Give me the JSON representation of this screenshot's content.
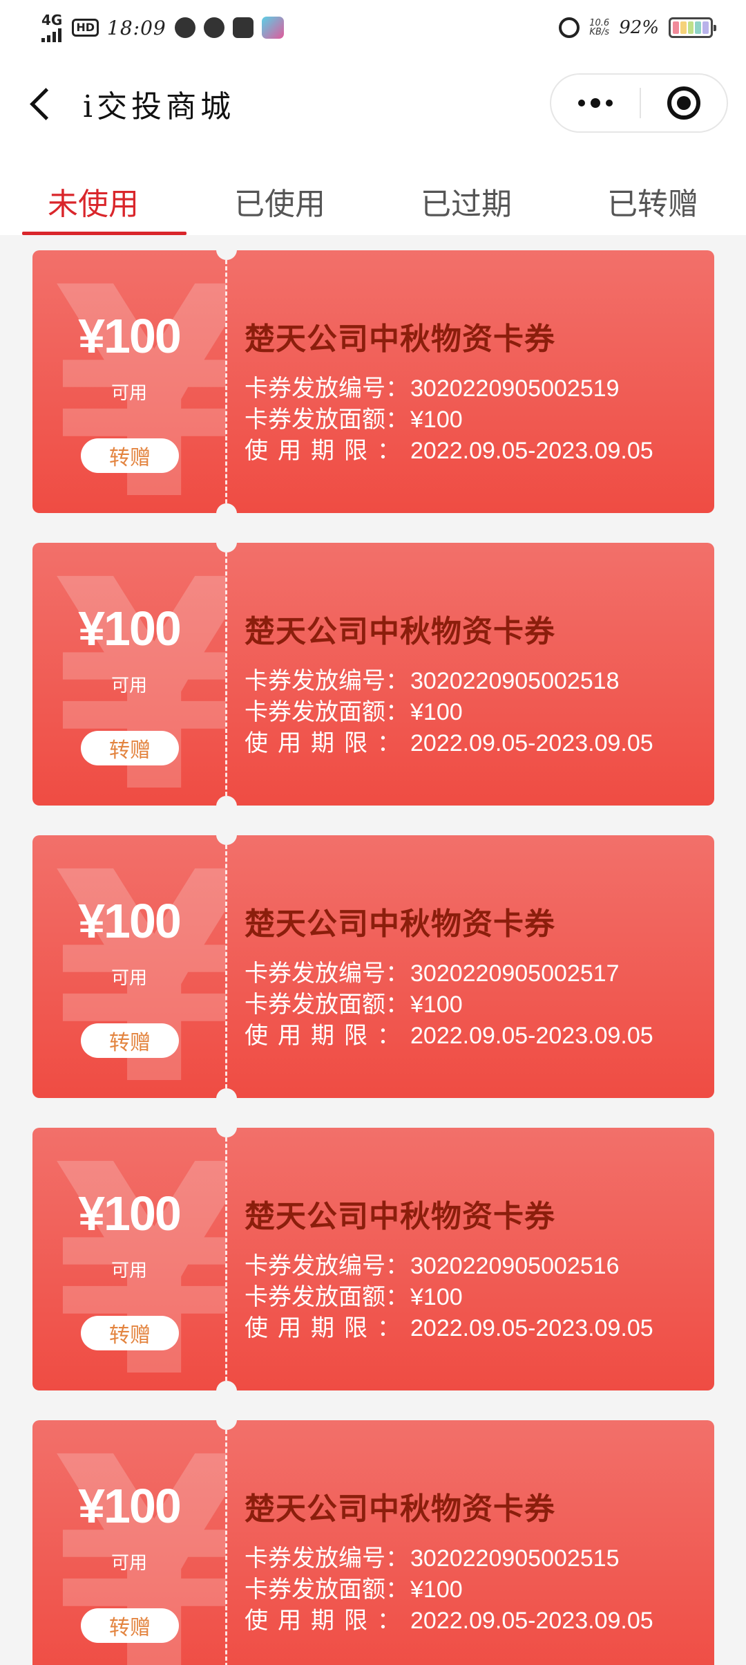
{
  "status_bar": {
    "network": "4G",
    "hd": "HD",
    "time": "18:09",
    "speed_value": "10.6",
    "speed_unit": "KB/s",
    "battery": "92%"
  },
  "header": {
    "title": "i交投商城"
  },
  "tabs": [
    {
      "label": "未使用",
      "active": true
    },
    {
      "label": "已使用",
      "active": false
    },
    {
      "label": "已过期",
      "active": false
    },
    {
      "label": "已转赠",
      "active": false
    }
  ],
  "coupon_labels": {
    "number": "卡券发放编号：",
    "value": "卡券发放面额：",
    "period": "使用期限："
  },
  "coupons": [
    {
      "amount": "¥100",
      "status": "可用",
      "gift_button": "转赠",
      "name": "楚天公司中秋物资卡券",
      "number": "3020220905002519",
      "value": "¥100",
      "period": "2022.09.05-2023.09.05"
    },
    {
      "amount": "¥100",
      "status": "可用",
      "gift_button": "转赠",
      "name": "楚天公司中秋物资卡券",
      "number": "3020220905002518",
      "value": "¥100",
      "period": "2022.09.05-2023.09.05"
    },
    {
      "amount": "¥100",
      "status": "可用",
      "gift_button": "转赠",
      "name": "楚天公司中秋物资卡券",
      "number": "3020220905002517",
      "value": "¥100",
      "period": "2022.09.05-2023.09.05"
    },
    {
      "amount": "¥100",
      "status": "可用",
      "gift_button": "转赠",
      "name": "楚天公司中秋物资卡券",
      "number": "3020220905002516",
      "value": "¥100",
      "period": "2022.09.05-2023.09.05"
    },
    {
      "amount": "¥100",
      "status": "可用",
      "gift_button": "转赠",
      "name": "楚天公司中秋物资卡券",
      "number": "3020220905002515",
      "value": "¥100",
      "period": "2022.09.05-2023.09.05"
    }
  ],
  "colors": {
    "accent": "#d9262b",
    "coupon_top": "#f2706a",
    "coupon_bottom": "#ef4c43",
    "coupon_title": "#8b1e0c",
    "gift_text": "#e3843f"
  }
}
